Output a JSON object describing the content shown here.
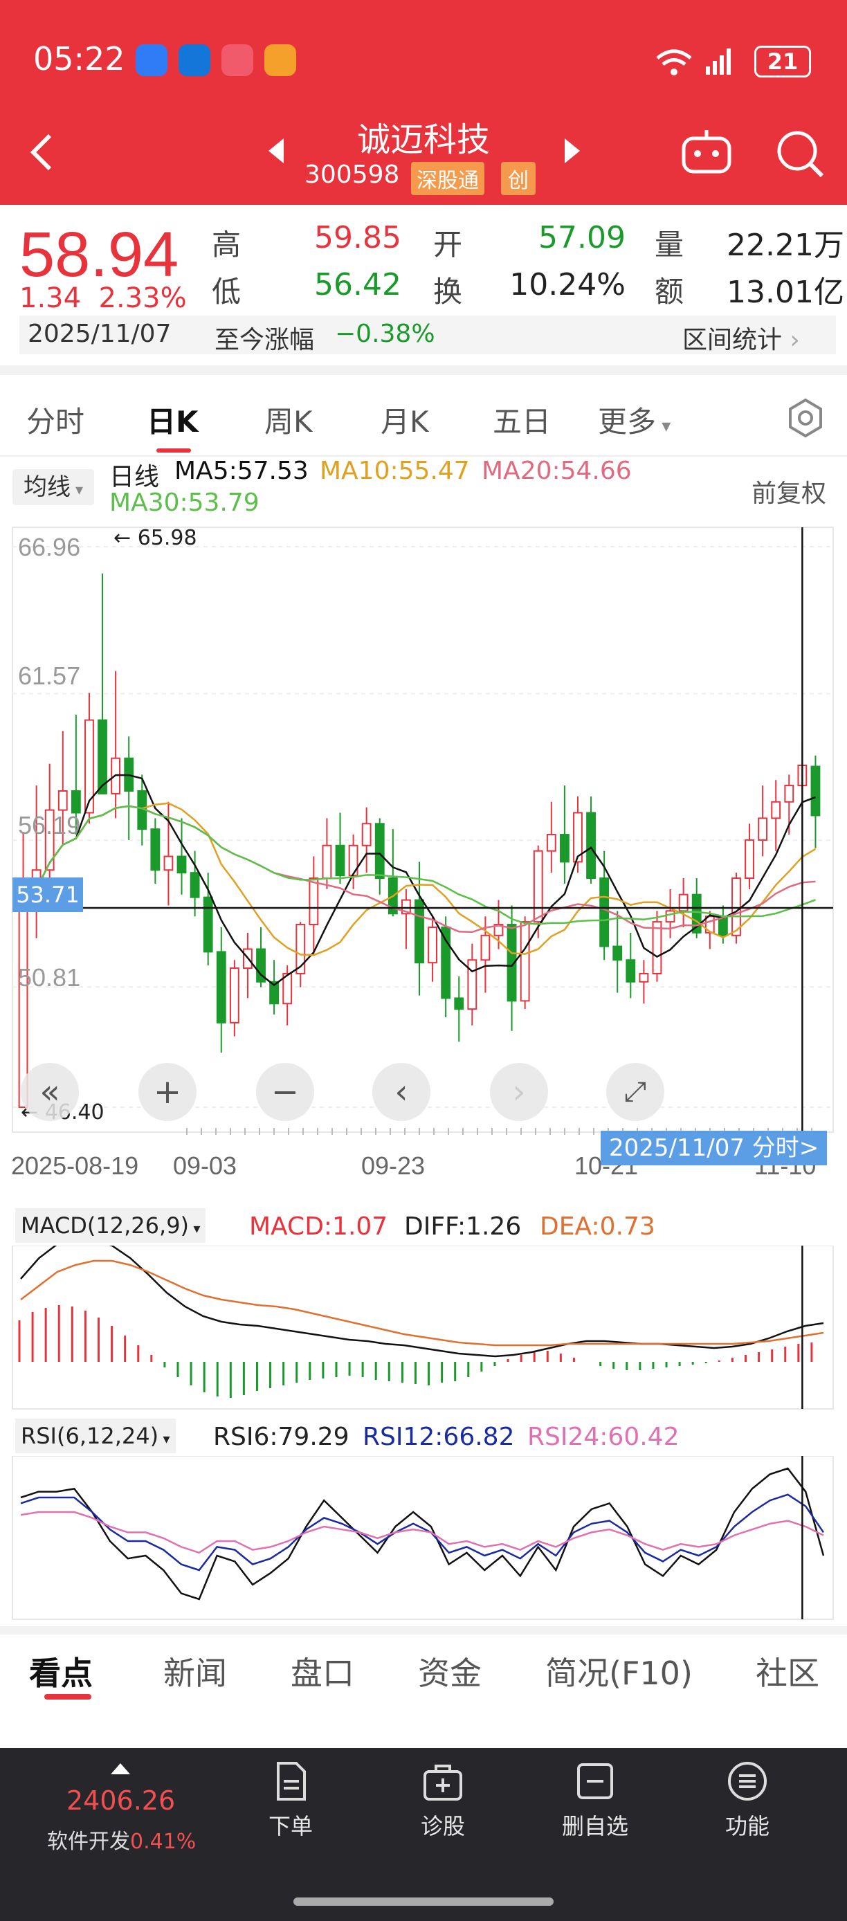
{
  "status_bar": {
    "time": "05:22",
    "battery": "21"
  },
  "header": {
    "title": "诚迈科技",
    "code": "300598",
    "tag_sgt": "深股通",
    "tag_chuang": "创"
  },
  "quote": {
    "price": "58.94",
    "change": "1.34",
    "change_pct": "2.33%",
    "high_label": "高",
    "high": "59.85",
    "low_label": "低",
    "low": "56.42",
    "open_label": "开",
    "open": "57.09",
    "turnover_label": "换",
    "turnover": "10.24%",
    "volume_label": "量",
    "volume": "22.21万",
    "amount_label": "额",
    "amount": "13.01亿",
    "date": "2025/11/07",
    "since_label": "至今涨幅",
    "since_value": "−0.38%",
    "interval_stats": "区间统计"
  },
  "tabs": [
    "分时",
    "日K",
    "周K",
    "月K",
    "五日",
    "更多"
  ],
  "chart": {
    "ma_selector": "均线",
    "period": "日线",
    "ma5": "MA5:57.53",
    "ma10": "MA10:55.47",
    "ma20": "MA20:54.66",
    "ma30": "MA30:53.79",
    "adjust": "前复权",
    "y_labels": [
      "66.96",
      "61.57",
      "56.19",
      "50.81",
      "46.40"
    ],
    "max_label": "65.98",
    "min_label": "46.40",
    "current_line": "53.71",
    "x_labels": [
      "2025-08-19",
      "09-03",
      "09-23",
      "10-21",
      "11-10"
    ],
    "cursor_date": "2025/11/07 分时>",
    "colors": {
      "up": "#e8333c",
      "down": "#1a9a2a",
      "ma5": "#111111",
      "ma10": "#e0a020",
      "ma20": "#e06a80",
      "ma30": "#5cbf4a"
    }
  },
  "chart_data": {
    "type": "candlestick",
    "title": "",
    "ylim": [
      46.4,
      66.96
    ],
    "y_ticks": [
      66.96,
      61.57,
      56.19,
      50.81,
      46.4
    ],
    "x_tick_labels": [
      "2025-08-19",
      "09-03",
      "09-23",
      "10-21",
      "11-10"
    ],
    "candles": [
      [
        46.4,
        56.5,
        46.4,
        53.7
      ],
      [
        53.8,
        58.2,
        52.6,
        55.1
      ],
      [
        55.1,
        59.0,
        54.2,
        57.3
      ],
      [
        57.3,
        60.2,
        56.0,
        58.0
      ],
      [
        58.0,
        60.8,
        56.4,
        57.2
      ],
      [
        57.2,
        61.6,
        56.8,
        60.6
      ],
      [
        60.6,
        65.98,
        59.8,
        57.9
      ],
      [
        57.9,
        62.4,
        57.0,
        59.2
      ],
      [
        59.2,
        60.0,
        56.2,
        58.0
      ],
      [
        58.0,
        58.6,
        56.0,
        56.6
      ],
      [
        56.6,
        57.0,
        54.6,
        55.1
      ],
      [
        55.1,
        57.6,
        53.8,
        55.6
      ],
      [
        55.6,
        57.0,
        54.2,
        55.0
      ],
      [
        55.0,
        55.8,
        53.4,
        54.1
      ],
      [
        54.1,
        55.0,
        51.6,
        52.1
      ],
      [
        52.1,
        53.0,
        48.4,
        49.5
      ],
      [
        49.5,
        51.8,
        49.0,
        51.5
      ],
      [
        51.5,
        52.8,
        50.4,
        52.2
      ],
      [
        52.2,
        53.0,
        50.8,
        51.0
      ],
      [
        51.0,
        51.8,
        49.8,
        50.2
      ],
      [
        50.2,
        51.6,
        49.4,
        51.3
      ],
      [
        51.3,
        53.2,
        50.8,
        53.1
      ],
      [
        53.1,
        55.6,
        52.0,
        54.8
      ],
      [
        54.8,
        57.0,
        54.4,
        56.0
      ],
      [
        56.0,
        57.2,
        54.6,
        54.9
      ],
      [
        54.9,
        56.4,
        54.4,
        56.0
      ],
      [
        56.0,
        57.4,
        55.0,
        56.8
      ],
      [
        56.8,
        57.0,
        54.2,
        54.8
      ],
      [
        54.8,
        56.6,
        53.4,
        53.5
      ],
      [
        53.5,
        54.4,
        52.2,
        54.0
      ],
      [
        54.0,
        55.4,
        50.5,
        51.7
      ],
      [
        51.7,
        53.4,
        51.0,
        53.0
      ],
      [
        53.0,
        53.4,
        49.7,
        50.4
      ],
      [
        50.4,
        51.2,
        48.8,
        50.0
      ],
      [
        50.0,
        52.4,
        49.4,
        51.8
      ],
      [
        51.8,
        53.4,
        50.6,
        52.7
      ],
      [
        52.7,
        54.0,
        52.2,
        53.1
      ],
      [
        53.1,
        53.8,
        49.2,
        50.3
      ],
      [
        50.3,
        53.4,
        50.0,
        53.2
      ],
      [
        53.2,
        56.0,
        52.6,
        55.8
      ],
      [
        55.8,
        57.6,
        55.0,
        56.4
      ],
      [
        56.4,
        58.2,
        54.6,
        55.4
      ],
      [
        55.4,
        57.8,
        55.0,
        57.2
      ],
      [
        57.2,
        57.8,
        54.6,
        54.8
      ],
      [
        54.8,
        55.8,
        51.8,
        52.3
      ],
      [
        52.3,
        53.6,
        50.6,
        51.8
      ],
      [
        51.8,
        52.8,
        50.4,
        51.0
      ],
      [
        51.0,
        51.8,
        50.2,
        51.3
      ],
      [
        51.3,
        53.6,
        51.0,
        53.2
      ],
      [
        53.2,
        54.4,
        52.6,
        53.6
      ],
      [
        53.6,
        54.8,
        53.0,
        54.2
      ],
      [
        54.2,
        54.8,
        52.6,
        52.8
      ],
      [
        52.8,
        53.6,
        52.2,
        53.4
      ],
      [
        53.4,
        53.8,
        52.4,
        52.7
      ],
      [
        52.7,
        55.0,
        52.4,
        54.8
      ],
      [
        54.8,
        56.8,
        54.4,
        56.2
      ],
      [
        56.2,
        58.2,
        55.6,
        57.0
      ],
      [
        57.0,
        58.4,
        55.8,
        57.6
      ],
      [
        57.6,
        58.6,
        56.4,
        58.2
      ],
      [
        58.2,
        59.85,
        56.42,
        58.94
      ],
      [
        58.9,
        59.3,
        55.9,
        57.1
      ]
    ],
    "legend": [
      "MA5:57.53",
      "MA10:55.47",
      "MA20:54.66",
      "MA30:53.79"
    ]
  },
  "macd": {
    "label": "MACD(12,26,9)",
    "macd": "MACD:1.07",
    "diff": "DIFF:1.26",
    "dea": "DEA:0.73"
  },
  "rsi": {
    "label": "RSI(6,12,24)",
    "rsi6": "RSI6:79.29",
    "rsi12": "RSI12:66.82",
    "rsi24": "RSI24:60.42"
  },
  "bottom_tabs": [
    "看点",
    "新闻",
    "盘口",
    "资金",
    "简况(F10)",
    "社区"
  ],
  "bottom_bar": {
    "index_value": "2406.26",
    "index_name": "软件开发",
    "index_pct": "0.41%",
    "items": [
      "下单",
      "诊股",
      "删自选",
      "功能"
    ]
  }
}
